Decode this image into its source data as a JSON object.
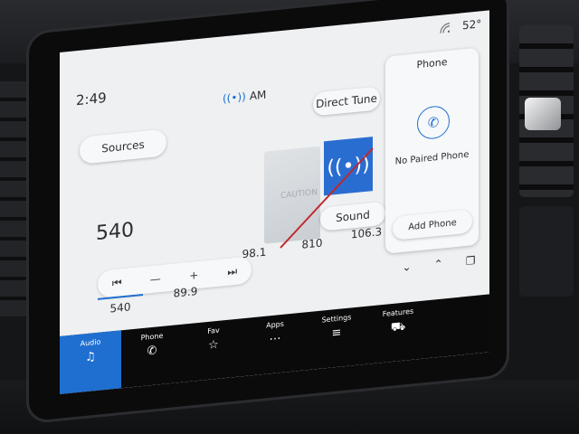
{
  "status": {
    "time": "2:49",
    "temperature": "52°"
  },
  "radio": {
    "band": "AM",
    "frequency": "540",
    "sources_label": "Sources",
    "direct_tune_label": "Direct Tune",
    "sound_label": "Sound",
    "album_art_text": "CAUTION",
    "controls": {
      "seek_back_icon": "⏮",
      "minus": "—",
      "plus": "+",
      "seek_forward_icon": "⏭"
    },
    "presets_top": [
      "98.1",
      "810",
      "106.3"
    ],
    "presets_bottom": [
      "540",
      "89.9"
    ]
  },
  "phone_panel": {
    "title": "Phone",
    "status": "No Paired Phone",
    "add_phone_label": "Add Phone"
  },
  "nav": {
    "items": [
      {
        "label": "Audio",
        "icon": "♫",
        "active": true
      },
      {
        "label": "Phone",
        "icon": "✆",
        "active": false
      },
      {
        "label": "Fav",
        "icon": "☆",
        "active": false
      },
      {
        "label": "Apps",
        "icon": "⋯",
        "active": false
      },
      {
        "label": "Settings",
        "icon": "≡",
        "active": false
      },
      {
        "label": "Features",
        "icon": "⛟",
        "active": false
      }
    ]
  },
  "colors": {
    "accent": "#1f6fd1",
    "screen_bg": "#eef0f2",
    "nav_bg": "#0a0a0b"
  }
}
